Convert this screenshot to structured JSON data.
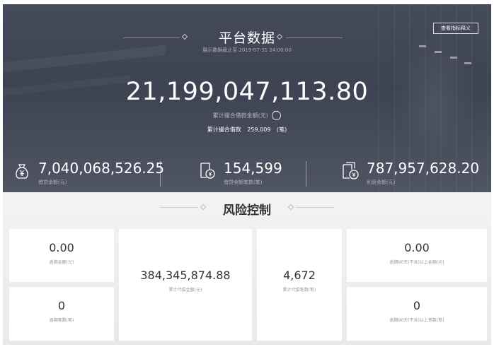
{
  "platform": {
    "title": "平台数据",
    "as_of": "展示数据截止至 2019-07-31 24:00:00",
    "indicator_button": "查看指标释义",
    "total_amount": "21,199,047,113.80",
    "total_amount_label": "累计撮合借款金额(元)",
    "count_label": "累计撮合借款",
    "count_value": "259,009",
    "count_unit": "(笔)",
    "stats": [
      {
        "value": "7,040,068,526.25",
        "label": "借贷余额(元)",
        "icon": "money-bag-yuan-icon"
      },
      {
        "value": "154,599",
        "label": "借贷余额笔数(笔)",
        "icon": "document-coin-icon"
      },
      {
        "value": "787,957,628.20",
        "label": "利息余额(元)",
        "icon": "stacked-documents-coin-icon"
      }
    ],
    "colors": {
      "hero_bg": "#434958",
      "text": "#ffffff"
    }
  },
  "risk": {
    "title": "风险控制",
    "cards": {
      "overdue_amount": {
        "value": "0.00",
        "label": "逾期金额(元)"
      },
      "overdue_count": {
        "value": "0",
        "label": "逾期笔数(笔)"
      },
      "compensated_amount": {
        "value": "384,345,874.88",
        "label": "累计代偿金额(元)"
      },
      "compensated_count": {
        "value": "4,672",
        "label": "累计代偿笔数(笔)"
      },
      "overdue90_amount": {
        "value": "0.00",
        "label": "逾期90天(不含)以上金额(元)"
      },
      "overdue90_count": {
        "value": "0",
        "label": "逾期90天(不含)以上笔数(笔)"
      }
    }
  }
}
